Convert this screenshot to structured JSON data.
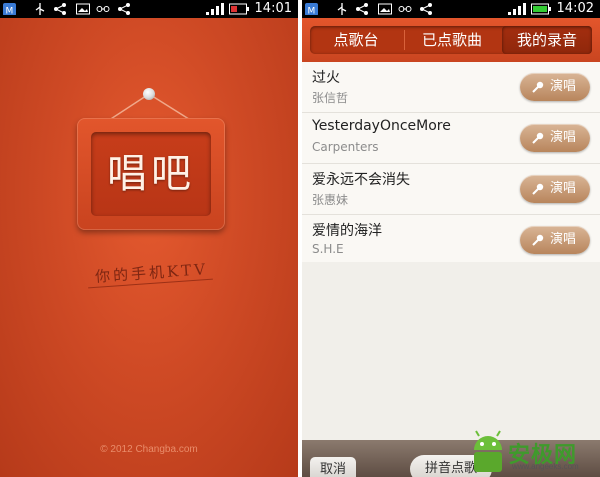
{
  "left_screen": {
    "status_time": "14:01",
    "board_text": "唱吧",
    "slogan": "你的手机KTV",
    "copyright": "© 2012 Changba.com"
  },
  "right_screen": {
    "status_time": "14:02",
    "tabs": [
      {
        "label": "点歌台",
        "active": false
      },
      {
        "label": "已点歌曲",
        "active": false
      },
      {
        "label": "我的录音",
        "active": true
      }
    ],
    "songs": [
      {
        "title": "过火",
        "artist": "张信哲",
        "action": "演唱"
      },
      {
        "title": "YesterdayOnceMore",
        "artist": "Carpenters",
        "action": "演唱"
      },
      {
        "title": "爱永远不会消失",
        "artist": "张惠妹",
        "action": "演唱"
      },
      {
        "title": "爱情的海洋",
        "artist": "S.H.E",
        "action": "演唱"
      }
    ],
    "bottom": {
      "cancel": "取消",
      "pinyin": "拼音点歌"
    }
  },
  "watermark": {
    "name": "安极网",
    "url": "www.angeeks.com"
  },
  "colors": {
    "brand_red": "#d44b25",
    "sing_button": "#c49470",
    "watermark_green": "#3f9a2c"
  }
}
